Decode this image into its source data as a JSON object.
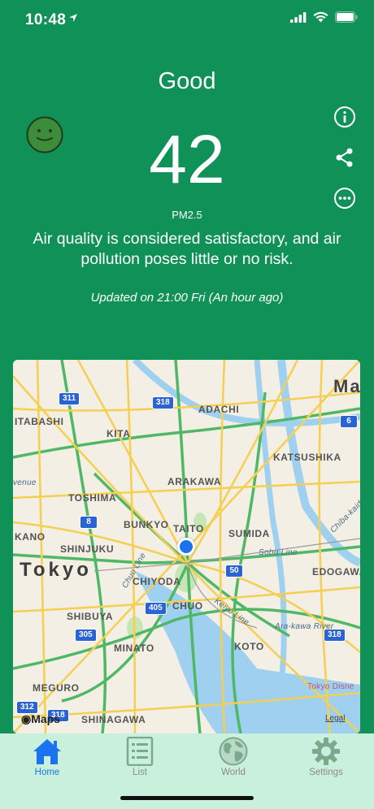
{
  "status_bar": {
    "time": "10:48"
  },
  "aqi": {
    "condition": "Good",
    "value": "42",
    "pollutant": "PM2.5",
    "description": "Air quality is considered satisfactory, and air pollution poses little or no risk.",
    "updated": "Updated on 21:00 Fri (An hour ago)",
    "color": "#0f9157"
  },
  "actions": [
    "info-icon",
    "share-icon",
    "more-icon"
  ],
  "map": {
    "city_label": "Tokyo",
    "labels": {
      "itabashi": "ITABASHI",
      "kita": "KITA",
      "adachi": "ADACHI",
      "katsushika": "KATSUSHIKA",
      "arakawa": "ARAKAWA",
      "toshima": "TOSHIMA",
      "bunkyo": "BUNKYO",
      "taito": "TAITO",
      "sumida": "SUMIDA",
      "nakano": "KANO",
      "shinjuku": "SHINJUKU",
      "chiyoda": "CHIYODA",
      "edogawa": "EDOGAWA",
      "shibuya": "SHIBUYA",
      "chuo": "CHUO",
      "minato": "MINATO",
      "koto": "KOTO",
      "meguro": "MEGURO",
      "shinagawa": "SHINAGAWA",
      "ma": "Ma",
      "avenue": "venue",
      "chuo_line": "Chuo Line",
      "sobu_line": "Sobu Line",
      "keiyo_line": "Keiyo Line",
      "arakawa_river": "Ara-kawa River",
      "chiba_kaido": "Chiba-kaido",
      "tokyo_disney": "Tokyo Disne"
    },
    "shields": {
      "r311": "311",
      "r318a": "318",
      "r6": "6",
      "r8": "8",
      "r50": "50",
      "r405": "405",
      "r305": "305",
      "r318b": "318",
      "r312": "312",
      "r318c": "318"
    },
    "maps_brand": "Maps",
    "legal": "Legal"
  },
  "tabs": [
    {
      "label": "Home",
      "icon": "home-icon",
      "active": true
    },
    {
      "label": "List",
      "icon": "list-icon",
      "active": false
    },
    {
      "label": "World",
      "icon": "globe-icon",
      "active": false
    },
    {
      "label": "Settings",
      "icon": "gear-icon",
      "active": false
    }
  ],
  "colors": {
    "active_tab": "#1a74f0",
    "tabbar_bg": "#c9f0dc"
  }
}
